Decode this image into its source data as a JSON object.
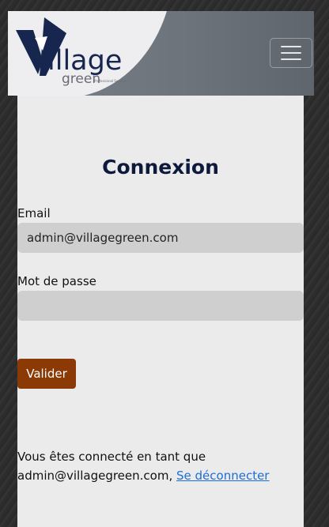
{
  "header": {
    "logo": {
      "icon": "village-green-logo",
      "wordmark": "illage",
      "subword": "green",
      "tagline": "Professional Services"
    },
    "menu_icon": "hamburger-menu-icon"
  },
  "login": {
    "title": "Connexion",
    "email_label": "Email",
    "email_value": "admin@villagegreen.com",
    "password_label": "Mot de passe",
    "password_value": "",
    "submit_label": "Valider"
  },
  "session": {
    "text_line1": "Vous êtes connecté en tant que",
    "user": "admin@villagegreen.com",
    "separator": ",",
    "logout_link": "Se déconnecter"
  },
  "colors": {
    "title": "#0e1a3b",
    "button": "#8b3a06",
    "link": "#1a6fd8",
    "field": "#cfcfcf",
    "card": "#ebebeb"
  }
}
